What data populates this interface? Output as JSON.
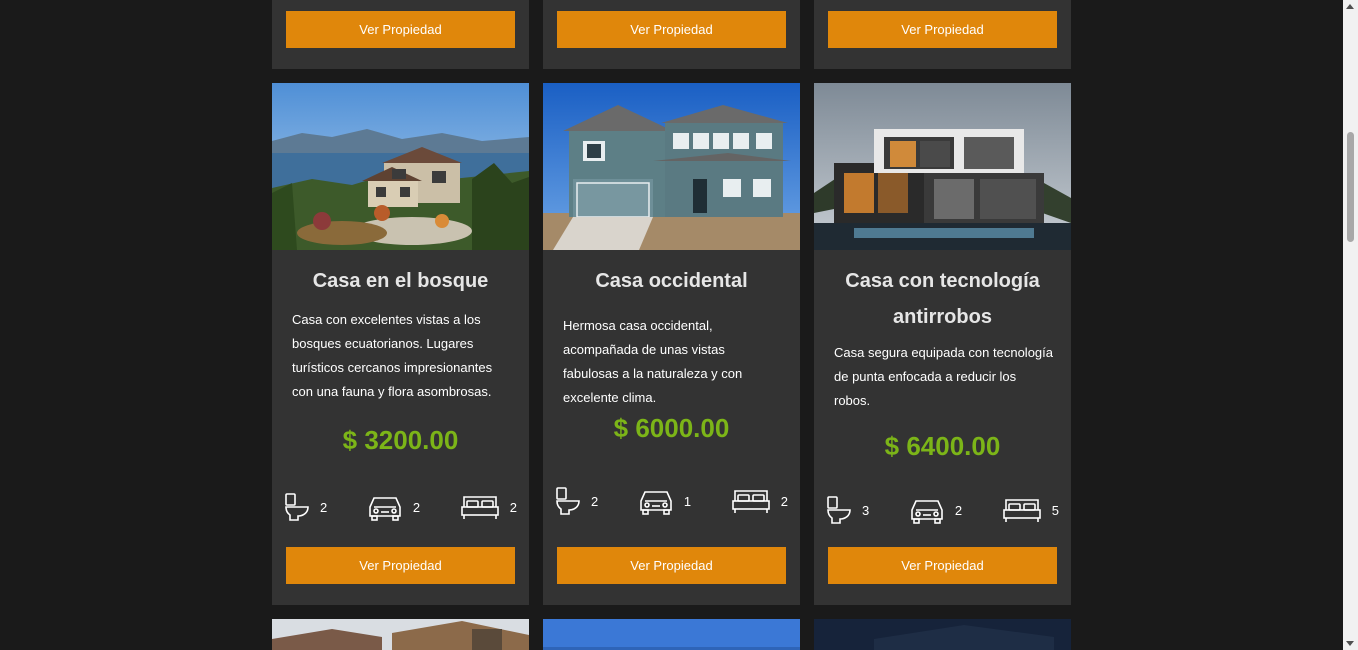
{
  "button_label": "Ver Propiedad",
  "currency_symbol": "$",
  "colors": {
    "page_background": "#1a1a1a",
    "card_background": "#333333",
    "button": "#e0870b",
    "price": "#7cb518",
    "title": "#e6e6e6"
  },
  "feature_icons": [
    "toilet-icon",
    "car-icon",
    "bed-icon"
  ],
  "properties": [
    {
      "title": "Casa en el bosque",
      "description": "Casa con excelentes vistas a los bosques ecuatorianos. Lugares turísticos cercanos impresionantes con una fauna y flora asombrosas.",
      "price": "$ 3200.00",
      "bathrooms": "2",
      "parking": "2",
      "bedrooms": "2"
    },
    {
      "title": "Casa occidental",
      "description": "Hermosa casa occidental, acompañada de unas vistas fabulosas a la naturaleza y con excelente clima.",
      "price": "$ 6000.00",
      "bathrooms": "2",
      "parking": "1",
      "bedrooms": "2"
    },
    {
      "title": "Casa con tecnología antirrobos",
      "description": "Casa segura equipada con tecnología de punta enfocada a reducir los robos.",
      "price": "$ 6400.00",
      "bathrooms": "3",
      "parking": "2",
      "bedrooms": "5"
    }
  ]
}
